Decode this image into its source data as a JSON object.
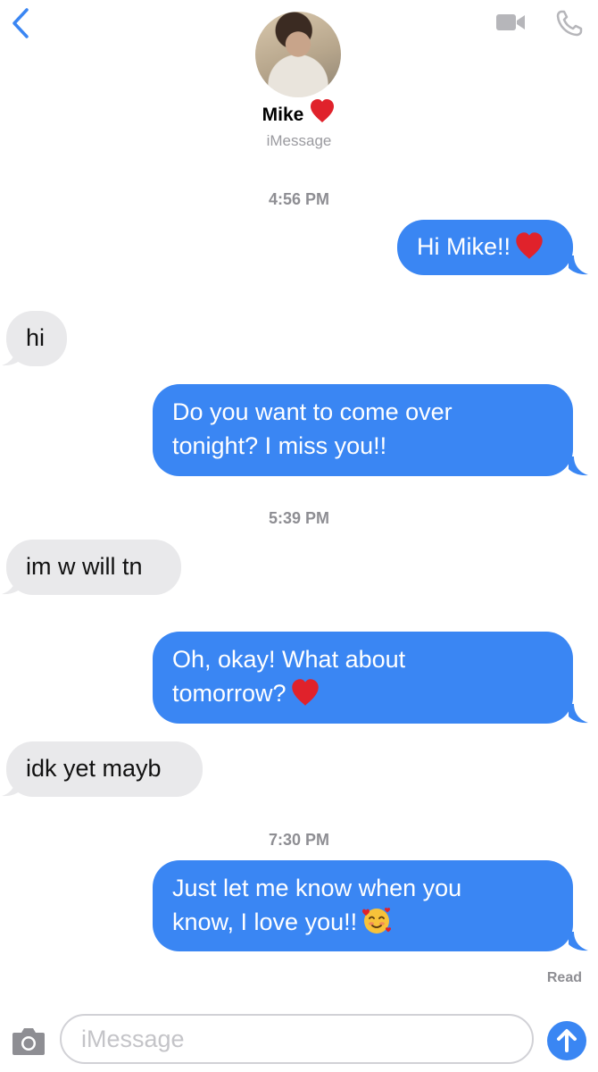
{
  "header": {
    "contact_name": "Mike",
    "service_label": "iMessage"
  },
  "messages": [
    {
      "type": "timestamp",
      "text": "4:56 PM"
    },
    {
      "type": "sent",
      "text": "Hi Mike!!",
      "emoji": "red-heart"
    },
    {
      "type": "received",
      "text": "hi"
    },
    {
      "type": "sent",
      "lines": [
        "Do you want to come over",
        "tonight? I miss you!!"
      ]
    },
    {
      "type": "timestamp",
      "text": "5:39 PM"
    },
    {
      "type": "received",
      "text": "im w will tn"
    },
    {
      "type": "sent",
      "lines": [
        "Oh, okay! What about",
        "tomorrow?"
      ],
      "emoji": "red-heart"
    },
    {
      "type": "received",
      "text": "idk yet mayb"
    },
    {
      "type": "timestamp",
      "text": "7:30 PM"
    },
    {
      "type": "sent",
      "lines": [
        "Just let me know when you",
        "know, I love you!!"
      ],
      "emoji": "smiling-face-with-hearts"
    }
  ],
  "status": {
    "read_label": "Read"
  },
  "composer": {
    "placeholder": "iMessage"
  },
  "colors": {
    "sent_bubble": "#3a86f3",
    "received_bubble": "#e9e9eb",
    "accent": "#3a86f3"
  },
  "icons": [
    "back-chevron-icon",
    "video-camera-icon",
    "phone-icon",
    "camera-icon",
    "send-arrow-icon"
  ]
}
